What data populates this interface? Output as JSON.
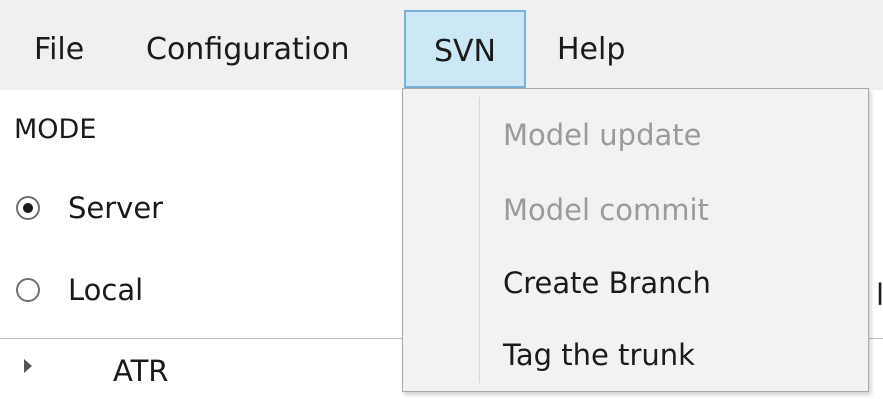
{
  "menubar": {
    "file": "File",
    "configuration": "Configuration",
    "svn": "SVN",
    "help": "Help"
  },
  "panel": {
    "mode_label": "MODE",
    "mode_options": [
      {
        "label": "Server",
        "selected": true
      },
      {
        "label": "Local",
        "selected": false
      }
    ],
    "tree_item": "ATR",
    "edge_text": "l"
  },
  "svn_menu": {
    "items": [
      {
        "label": "Model update",
        "enabled": false
      },
      {
        "label": "Model commit",
        "enabled": false
      },
      {
        "label": "Create Branch",
        "enabled": true
      },
      {
        "label": "Tag the trunk",
        "enabled": true
      }
    ]
  },
  "colors": {
    "menubar_bg": "#f0f0f0",
    "active_menu_bg": "#cce8f7",
    "active_menu_border": "#7ab2d3",
    "dropdown_bg": "#f2f2f2",
    "disabled_text": "#9a9a9a"
  }
}
